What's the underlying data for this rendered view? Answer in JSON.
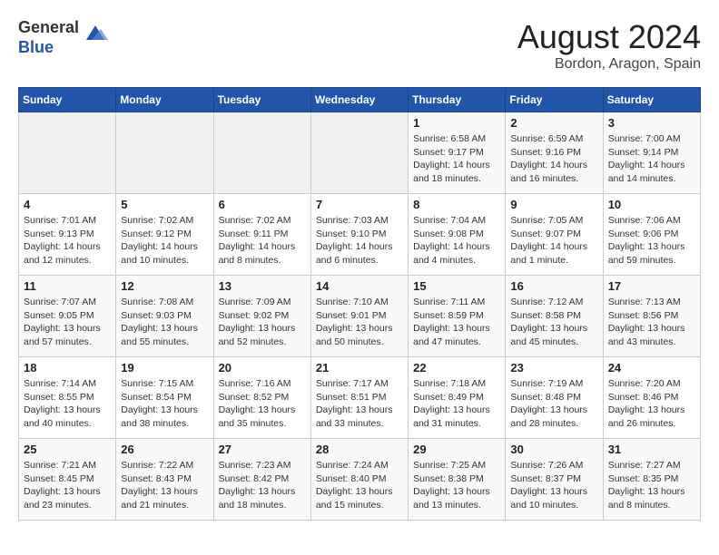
{
  "header": {
    "logo_line1": "General",
    "logo_line2": "Blue",
    "title": "August 2024",
    "subtitle": "Bordon, Aragon, Spain"
  },
  "days_of_week": [
    "Sunday",
    "Monday",
    "Tuesday",
    "Wednesday",
    "Thursday",
    "Friday",
    "Saturday"
  ],
  "weeks": [
    [
      {
        "day": "",
        "info": ""
      },
      {
        "day": "",
        "info": ""
      },
      {
        "day": "",
        "info": ""
      },
      {
        "day": "",
        "info": ""
      },
      {
        "day": "1",
        "info": "Sunrise: 6:58 AM\nSunset: 9:17 PM\nDaylight: 14 hours\nand 18 minutes."
      },
      {
        "day": "2",
        "info": "Sunrise: 6:59 AM\nSunset: 9:16 PM\nDaylight: 14 hours\nand 16 minutes."
      },
      {
        "day": "3",
        "info": "Sunrise: 7:00 AM\nSunset: 9:14 PM\nDaylight: 14 hours\nand 14 minutes."
      }
    ],
    [
      {
        "day": "4",
        "info": "Sunrise: 7:01 AM\nSunset: 9:13 PM\nDaylight: 14 hours\nand 12 minutes."
      },
      {
        "day": "5",
        "info": "Sunrise: 7:02 AM\nSunset: 9:12 PM\nDaylight: 14 hours\nand 10 minutes."
      },
      {
        "day": "6",
        "info": "Sunrise: 7:02 AM\nSunset: 9:11 PM\nDaylight: 14 hours\nand 8 minutes."
      },
      {
        "day": "7",
        "info": "Sunrise: 7:03 AM\nSunset: 9:10 PM\nDaylight: 14 hours\nand 6 minutes."
      },
      {
        "day": "8",
        "info": "Sunrise: 7:04 AM\nSunset: 9:08 PM\nDaylight: 14 hours\nand 4 minutes."
      },
      {
        "day": "9",
        "info": "Sunrise: 7:05 AM\nSunset: 9:07 PM\nDaylight: 14 hours\nand 1 minute."
      },
      {
        "day": "10",
        "info": "Sunrise: 7:06 AM\nSunset: 9:06 PM\nDaylight: 13 hours\nand 59 minutes."
      }
    ],
    [
      {
        "day": "11",
        "info": "Sunrise: 7:07 AM\nSunset: 9:05 PM\nDaylight: 13 hours\nand 57 minutes."
      },
      {
        "day": "12",
        "info": "Sunrise: 7:08 AM\nSunset: 9:03 PM\nDaylight: 13 hours\nand 55 minutes."
      },
      {
        "day": "13",
        "info": "Sunrise: 7:09 AM\nSunset: 9:02 PM\nDaylight: 13 hours\nand 52 minutes."
      },
      {
        "day": "14",
        "info": "Sunrise: 7:10 AM\nSunset: 9:01 PM\nDaylight: 13 hours\nand 50 minutes."
      },
      {
        "day": "15",
        "info": "Sunrise: 7:11 AM\nSunset: 8:59 PM\nDaylight: 13 hours\nand 47 minutes."
      },
      {
        "day": "16",
        "info": "Sunrise: 7:12 AM\nSunset: 8:58 PM\nDaylight: 13 hours\nand 45 minutes."
      },
      {
        "day": "17",
        "info": "Sunrise: 7:13 AM\nSunset: 8:56 PM\nDaylight: 13 hours\nand 43 minutes."
      }
    ],
    [
      {
        "day": "18",
        "info": "Sunrise: 7:14 AM\nSunset: 8:55 PM\nDaylight: 13 hours\nand 40 minutes."
      },
      {
        "day": "19",
        "info": "Sunrise: 7:15 AM\nSunset: 8:54 PM\nDaylight: 13 hours\nand 38 minutes."
      },
      {
        "day": "20",
        "info": "Sunrise: 7:16 AM\nSunset: 8:52 PM\nDaylight: 13 hours\nand 35 minutes."
      },
      {
        "day": "21",
        "info": "Sunrise: 7:17 AM\nSunset: 8:51 PM\nDaylight: 13 hours\nand 33 minutes."
      },
      {
        "day": "22",
        "info": "Sunrise: 7:18 AM\nSunset: 8:49 PM\nDaylight: 13 hours\nand 31 minutes."
      },
      {
        "day": "23",
        "info": "Sunrise: 7:19 AM\nSunset: 8:48 PM\nDaylight: 13 hours\nand 28 minutes."
      },
      {
        "day": "24",
        "info": "Sunrise: 7:20 AM\nSunset: 8:46 PM\nDaylight: 13 hours\nand 26 minutes."
      }
    ],
    [
      {
        "day": "25",
        "info": "Sunrise: 7:21 AM\nSunset: 8:45 PM\nDaylight: 13 hours\nand 23 minutes."
      },
      {
        "day": "26",
        "info": "Sunrise: 7:22 AM\nSunset: 8:43 PM\nDaylight: 13 hours\nand 21 minutes."
      },
      {
        "day": "27",
        "info": "Sunrise: 7:23 AM\nSunset: 8:42 PM\nDaylight: 13 hours\nand 18 minutes."
      },
      {
        "day": "28",
        "info": "Sunrise: 7:24 AM\nSunset: 8:40 PM\nDaylight: 13 hours\nand 15 minutes."
      },
      {
        "day": "29",
        "info": "Sunrise: 7:25 AM\nSunset: 8:38 PM\nDaylight: 13 hours\nand 13 minutes."
      },
      {
        "day": "30",
        "info": "Sunrise: 7:26 AM\nSunset: 8:37 PM\nDaylight: 13 hours\nand 10 minutes."
      },
      {
        "day": "31",
        "info": "Sunrise: 7:27 AM\nSunset: 8:35 PM\nDaylight: 13 hours\nand 8 minutes."
      }
    ]
  ]
}
